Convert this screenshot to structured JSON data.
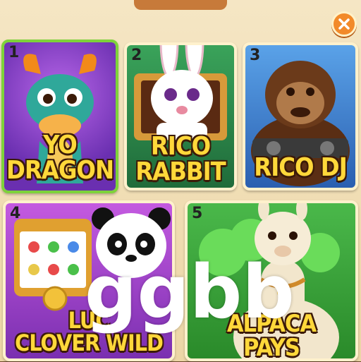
{
  "close_button": {
    "icon": "close-icon",
    "color": "#f28a2a"
  },
  "games": [
    {
      "number": "1",
      "title_lines": [
        "YO",
        "DRAGON"
      ],
      "selected": true,
      "bg": "#7b3cc2",
      "character": "dragon-icon"
    },
    {
      "number": "2",
      "title_lines": [
        "RICO",
        "RABBIT"
      ],
      "selected": false,
      "bg": "#2c8b4c",
      "character": "rabbit-icon"
    },
    {
      "number": "3",
      "title_lines": [
        "RICO DJ"
      ],
      "selected": false,
      "bg": "#2a6fc9",
      "character": "gorilla-icon"
    },
    {
      "number": "4",
      "title_lines": [
        "LUC",
        "CLOVER WILD"
      ],
      "selected": false,
      "bg": "#b548d6",
      "character": "panda-icon"
    },
    {
      "number": "5",
      "title_lines": [
        "ALPACA",
        "PAYS"
      ],
      "selected": false,
      "bg": "#2f9a3a",
      "character": "alpaca-icon"
    }
  ],
  "watermark": "ggbb"
}
